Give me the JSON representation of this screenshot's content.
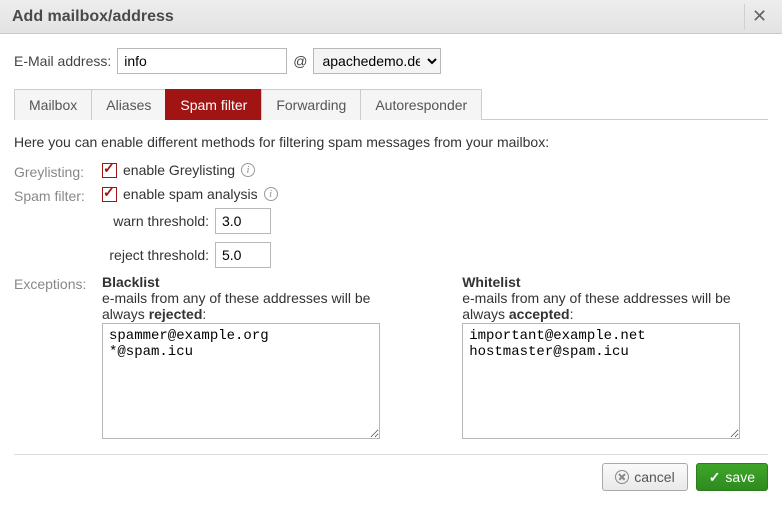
{
  "dialog": {
    "title": "Add mailbox/address"
  },
  "email": {
    "label": "E-Mail address:",
    "value": "info",
    "at": "@",
    "domain_selected": "apachedemo.de"
  },
  "tabs": {
    "mailbox": "Mailbox",
    "aliases": "Aliases",
    "spam": "Spam filter",
    "forwarding": "Forwarding",
    "autoresponder": "Autoresponder"
  },
  "spam": {
    "intro": "Here you can enable different methods for filtering spam messages from your mailbox:",
    "greylisting_label": "Greylisting:",
    "greylisting_cb": "enable Greylisting",
    "filter_label": "Spam filter:",
    "filter_cb": "enable spam analysis",
    "warn_label": "warn threshold:",
    "warn_value": "3.0",
    "reject_label": "reject threshold:",
    "reject_value": "5.0",
    "exceptions_label": "Exceptions:",
    "blacklist": {
      "title": "Blacklist",
      "desc": "e-mails from any of these addresses will be always rejected:",
      "value": "spammer@example.org\n*@spam.icu"
    },
    "whitelist": {
      "title": "Whitelist",
      "desc": "e-mails from any of these addresses will be always accepted:",
      "value": "important@example.net\nhostmaster@spam.icu"
    }
  },
  "buttons": {
    "cancel": "cancel",
    "save": "save"
  }
}
